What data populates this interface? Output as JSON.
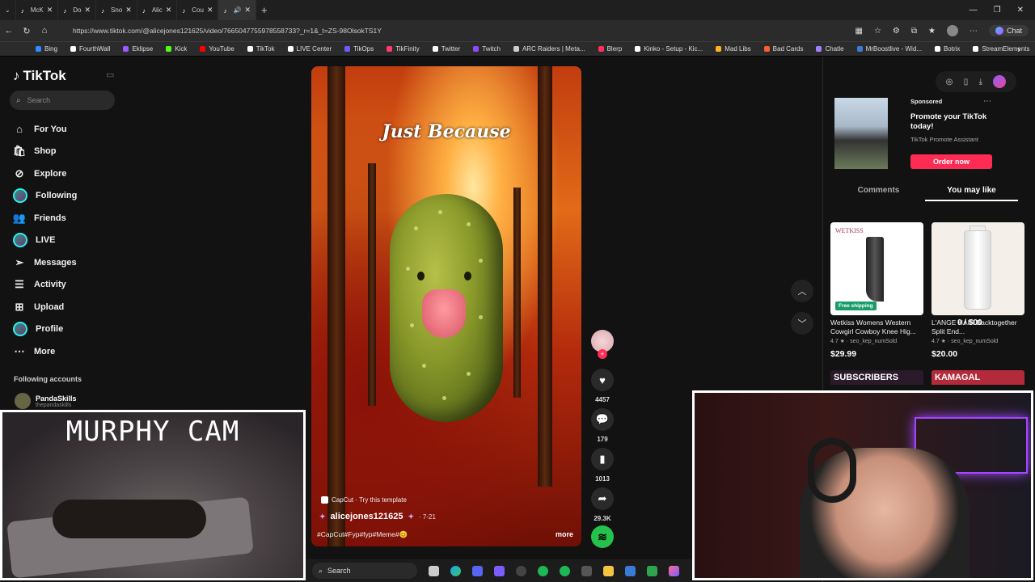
{
  "browser": {
    "tabs": [
      {
        "label": "McK"
      },
      {
        "label": "Do"
      },
      {
        "label": "Sno"
      },
      {
        "label": "Alic"
      },
      {
        "label": "Cou"
      },
      {
        "label": ""
      }
    ],
    "url": "https://www.tiktok.com/@alicejones121625/video/7665047755978558733?_r=1&_t=ZS-98OlsokTS1Y",
    "chat_label": "Chat",
    "bookmarks": [
      {
        "label": "Bing",
        "color": "#2d8cff"
      },
      {
        "label": "FourthWall",
        "color": "#ffffff"
      },
      {
        "label": "Eklipse",
        "color": "#9b59ff"
      },
      {
        "label": "Kick",
        "color": "#53fc18"
      },
      {
        "label": "YouTube",
        "color": "#ff0000"
      },
      {
        "label": "TikTok",
        "color": "#ffffff"
      },
      {
        "label": "LIVE Center",
        "color": "#ffffff"
      },
      {
        "label": "TikOps",
        "color": "#6a5cff"
      },
      {
        "label": "TikFinity",
        "color": "#ff3b6b"
      },
      {
        "label": "Twitter",
        "color": "#ffffff"
      },
      {
        "label": "Twitch",
        "color": "#9146ff"
      },
      {
        "label": "ARC Raiders | Meta...",
        "color": "#cccccc"
      },
      {
        "label": "Blerp",
        "color": "#ff2f5b"
      },
      {
        "label": "Kinko - Setup - Kic...",
        "color": "#ffffff"
      },
      {
        "label": "Mad Libs",
        "color": "#ffb020"
      },
      {
        "label": "Bad Cards",
        "color": "#ff5a36"
      },
      {
        "label": "Chatle",
        "color": "#a080ff"
      },
      {
        "label": "MrBoostlive - Wid...",
        "color": "#3a7bd5"
      },
      {
        "label": "Botrix",
        "color": "#ffffff"
      },
      {
        "label": "StreamElements",
        "color": "#ffffff"
      }
    ]
  },
  "sidebar": {
    "logo": "TikTok",
    "search_placeholder": "Search",
    "items": [
      {
        "label": "For You",
        "icon": "home-icon"
      },
      {
        "label": "Shop",
        "icon": "shop-icon"
      },
      {
        "label": "Explore",
        "icon": "compass-icon"
      },
      {
        "label": "Following",
        "icon": "avatar-icon"
      },
      {
        "label": "Friends",
        "icon": "friends-icon"
      },
      {
        "label": "LIVE",
        "icon": "avatar-icon"
      },
      {
        "label": "Messages",
        "icon": "send-icon"
      },
      {
        "label": "Activity",
        "icon": "inbox-icon"
      },
      {
        "label": "Upload",
        "icon": "plus-square-icon"
      },
      {
        "label": "Profile",
        "icon": "avatar-icon"
      },
      {
        "label": "More",
        "icon": "more-icon"
      }
    ],
    "following_heading": "Following accounts",
    "following": [
      {
        "name": "PandaSkills",
        "handle": "thepandaskills"
      }
    ]
  },
  "video": {
    "overlay_title": "Just Because",
    "capcut_label": "CapCut · Try this template",
    "author": "alicejones121625",
    "date": "· 7-21",
    "caption": "#CapCut#Fyp#fyp#Meme#😊",
    "more_label": "more"
  },
  "actions": {
    "likes": "4457",
    "comments": "179",
    "saves": "1013",
    "shares": "29.3K"
  },
  "right_panel": {
    "sponsored": "Sponsored",
    "ad_title": "Promote your TikTok today!",
    "ad_sub": "TikTok Promote Assistant",
    "ad_button": "Order now",
    "tabs": [
      "Comments",
      "You may like"
    ],
    "active_tab": "You may like",
    "products": [
      {
        "brand": "WETKISS",
        "badge": "Free shipping",
        "name": "Wetkiss Womens Western Cowgirl Cowboy Knee Hig...",
        "rating": "4.7 ★ · seo_kep_numSold",
        "price": "$29.99"
      },
      {
        "brand": "",
        "badge": "",
        "name": "L'ANGE HAIR Backtogether Split End...",
        "rating": "4.7 ★ · seo_kep_numSold",
        "price": "$20.00"
      }
    ],
    "overlay_price": "0 / 500",
    "next_thumbs": [
      "SUBSCRIBERS",
      "KAMAGAL"
    ]
  },
  "cam1": {
    "title": "MURPHY CAM"
  },
  "taskbar": {
    "search": "Search"
  }
}
